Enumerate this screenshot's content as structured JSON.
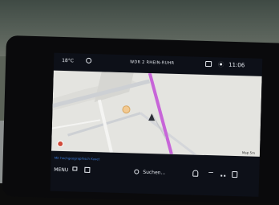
{
  "status": {
    "temperature": "18°C",
    "station": "WDR 2 RHEIN-RUHR",
    "time": "11:06"
  },
  "map": {
    "scale_label": "Map 5m",
    "info_line": "Mit hochgeographisch Kuset",
    "colors": {
      "background": "#e4e4e0",
      "road": "#cdd0d4",
      "route": "#c765d8"
    }
  },
  "bottombar": {
    "menu_label": "MENU",
    "search_label": "Suchen..."
  }
}
